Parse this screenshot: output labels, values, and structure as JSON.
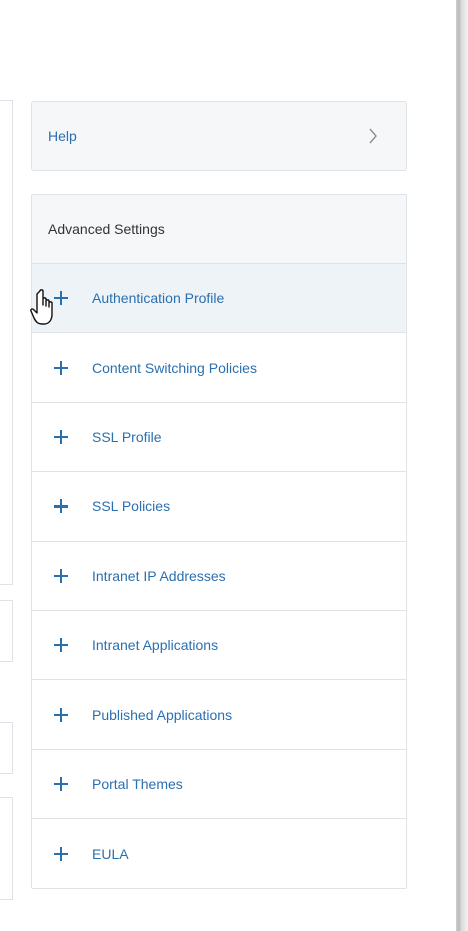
{
  "help": {
    "label": "Help",
    "icon": "chevron-right-icon"
  },
  "advanced": {
    "title": "Advanced Settings",
    "items": [
      {
        "label": "Authentication Profile"
      },
      {
        "label": "Content Switching Policies"
      },
      {
        "label": "SSL Profile"
      },
      {
        "label": "SSL Policies"
      },
      {
        "label": "Intranet IP Addresses"
      },
      {
        "label": "Intranet Applications"
      },
      {
        "label": "Published Applications"
      },
      {
        "label": "Portal Themes"
      },
      {
        "label": "EULA"
      }
    ]
  },
  "colors": {
    "accent": "#2a6fb0",
    "card_bg": "#f5f7f9",
    "border": "#dfe3e8",
    "hover_bg": "#eef3f8"
  }
}
